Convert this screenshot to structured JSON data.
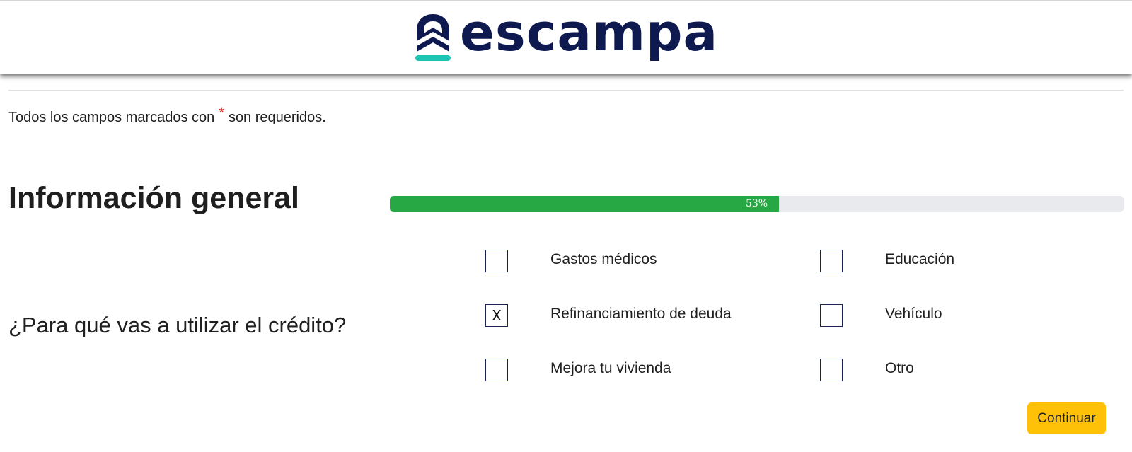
{
  "header": {
    "logo_text": "escampa",
    "logo_icon": "escampa-house-logo-icon",
    "brand_color": "#0e1a4f",
    "accent_color": "#1cc4b4"
  },
  "form": {
    "required_note": "Todos los campos marcados con",
    "required_asterisk": "*",
    "required_note_end": "son requeridos.",
    "section_title": "Información general",
    "progress": {
      "percent": 53,
      "label": "53%",
      "color": "#28a745"
    },
    "question": "¿Para qué vas a utilizar el crédito?",
    "options": [
      {
        "label": "Gastos médicos",
        "checked": false,
        "mark": ""
      },
      {
        "label": "Educación",
        "checked": false,
        "mark": ""
      },
      {
        "label": "Refinanciamiento de deuda",
        "checked": true,
        "mark": "X"
      },
      {
        "label": "Vehículo",
        "checked": false,
        "mark": ""
      },
      {
        "label": "Mejora tu vivienda",
        "checked": false,
        "mark": ""
      },
      {
        "label": "Otro",
        "checked": false,
        "mark": ""
      }
    ],
    "continue_label": "Continuar",
    "continue_color": "#ffc107"
  }
}
